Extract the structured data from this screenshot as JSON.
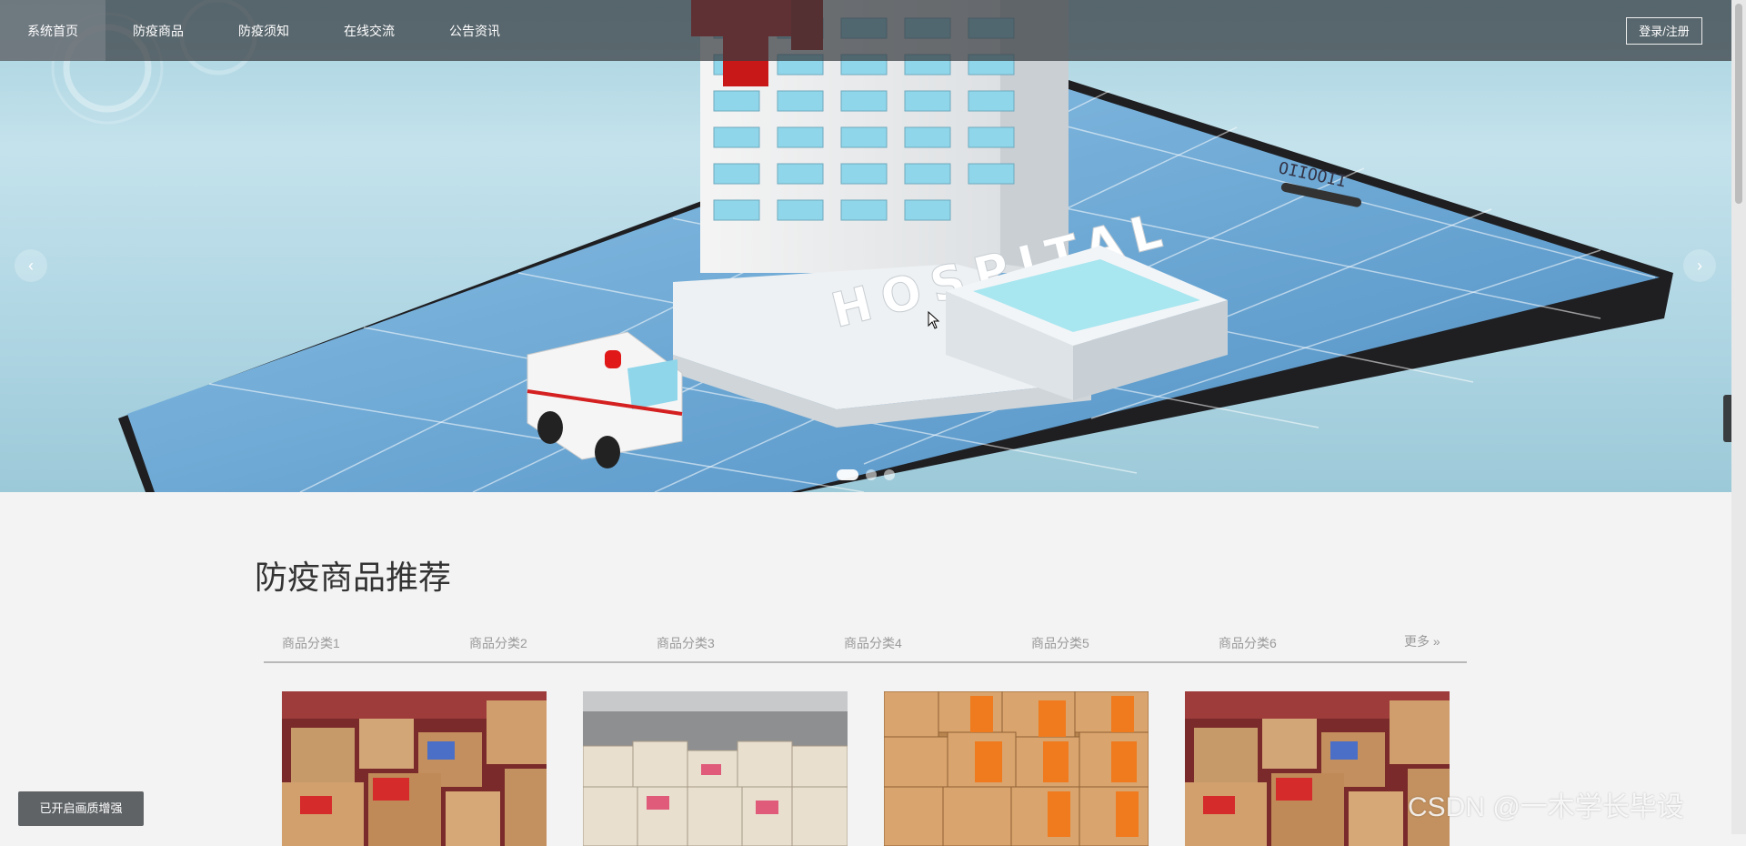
{
  "nav": {
    "items": [
      {
        "label": "系统首页",
        "active": true
      },
      {
        "label": "防疫商品"
      },
      {
        "label": "防疫须知"
      },
      {
        "label": "在线交流"
      },
      {
        "label": "公告资讯"
      }
    ],
    "login_label": "登录/注册"
  },
  "hero": {
    "sign_text": "HOSPITAL",
    "phone_label": "OIIOOII",
    "prev_icon": "chevron-left-icon",
    "next_icon": "chevron-right-icon",
    "slides_count": 3,
    "active_slide": 1
  },
  "section": {
    "title": "防疫商品推荐",
    "categories": [
      "商品分类1",
      "商品分类2",
      "商品分类3",
      "商品分类4",
      "商品分类5",
      "商品分类6"
    ],
    "more_label": "更多 »"
  },
  "products": [
    {
      "image": "boxes-warehouse-red"
    },
    {
      "image": "boxes-warehouse-stacked"
    },
    {
      "image": "boxes-warehouse-orange"
    },
    {
      "image": "boxes-warehouse-red"
    }
  ],
  "overlay": {
    "enhance_label": "已开启画质增强",
    "watermark": "CSDN @一木学长毕设",
    "side_tab_icon": "chevron-left-icon"
  },
  "colors": {
    "nav_bg": "#373c40",
    "page_bg": "#f3f3f3",
    "hero_sky": "#b3d8e5",
    "hospital_cross": "#c81818"
  }
}
